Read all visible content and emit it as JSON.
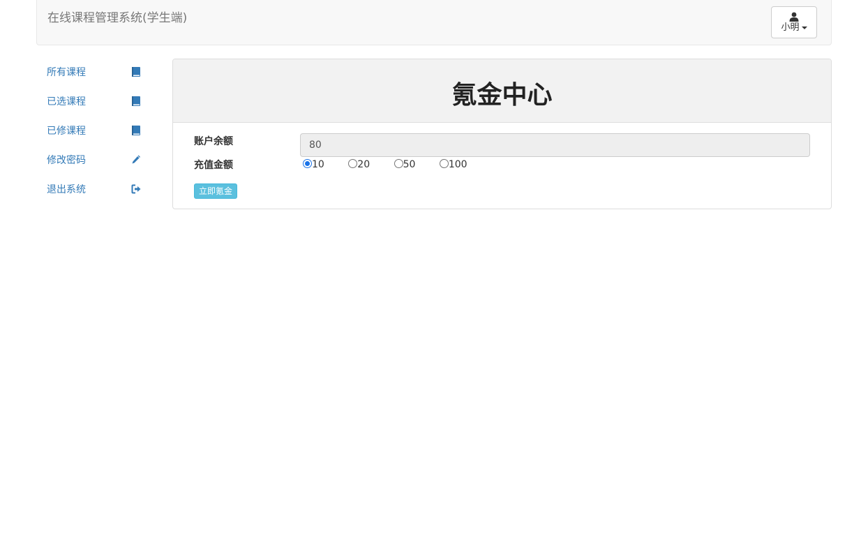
{
  "app": {
    "title": "在线课程管理系统(学生端)"
  },
  "user": {
    "name": "小明",
    "icon": "user-icon"
  },
  "sidebar": {
    "items": [
      {
        "label": "所有课程",
        "icon": "book-icon"
      },
      {
        "label": "已选课程",
        "icon": "book-icon"
      },
      {
        "label": "已修课程",
        "icon": "book-icon"
      },
      {
        "label": "修改密码",
        "icon": "pencil-icon"
      },
      {
        "label": "退出系统",
        "icon": "logout-icon"
      }
    ]
  },
  "main": {
    "heading": "氪金中心",
    "balance_label": "账户余额",
    "balance_value": "80",
    "recharge_label": "充值金额",
    "recharge_options": [
      "10",
      "20",
      "50",
      "100"
    ],
    "recharge_selected": "10",
    "submit_label": "立即氪金"
  },
  "colors": {
    "link": "#337ab7",
    "info_button": "#5bc0de",
    "navbar_bg": "#f8f8f8"
  }
}
